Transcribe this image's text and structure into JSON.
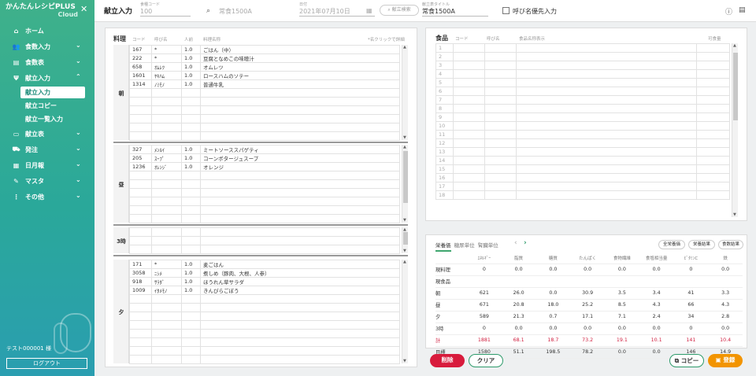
{
  "app": {
    "title_line1": "かんたんレシピPLUS",
    "title_line2": "Cloud"
  },
  "sidebar": {
    "items": [
      {
        "icon": "home-icon",
        "label": "ホーム",
        "chev": ""
      },
      {
        "icon": "people-icon",
        "label": "食数入力",
        "chev": "⌄"
      },
      {
        "icon": "table-icon",
        "label": "食数表",
        "chev": "⌄"
      },
      {
        "icon": "utensils-icon",
        "label": "献立入力",
        "chev": "⌃"
      }
    ],
    "sub_items": [
      {
        "label": "献立入力",
        "active": true
      },
      {
        "label": "献立コピー",
        "active": false
      },
      {
        "label": "献立一覧入力",
        "active": false
      }
    ],
    "items2": [
      {
        "icon": "monitor-icon",
        "label": "献立表",
        "chev": "⌄"
      },
      {
        "icon": "truck-icon",
        "label": "発注",
        "chev": "⌄"
      },
      {
        "icon": "calendar-icon",
        "label": "日月報",
        "chev": "⌄"
      },
      {
        "icon": "pencil-icon",
        "label": "マスタ",
        "chev": "⌄"
      },
      {
        "icon": "dots-icon",
        "label": "その他",
        "chev": "⌄"
      }
    ],
    "user": "テスト000001 様",
    "logout": "ログアウト"
  },
  "topbar": {
    "title": "献立入力",
    "code_label": "食種コード",
    "code_value": "100",
    "meal_type": "常食1500A",
    "date_label": "日付",
    "date_value": "2021年07月10日",
    "search_btn": "献立検索",
    "menu_title_label": "献立表タイトル",
    "menu_title_value": "常食1500A",
    "pref_label": "呼び名優先入力"
  },
  "menu_panel": {
    "h_cuisine": "料理",
    "h_code": "コード",
    "h_alias": "呼び名",
    "h_servings": "人前",
    "h_name": "料理名称",
    "hint": "*名クリックで詳細",
    "meals": [
      {
        "label": "朝",
        "rows": [
          {
            "code": "167",
            "alias": "*",
            "serv": "1.0",
            "name": "ごはん（中）"
          },
          {
            "code": "222",
            "alias": "*",
            "serv": "1.0",
            "name": "豆腐となめこの味噌汁"
          },
          {
            "code": "658",
            "alias": "ｵﾑﾚﾂ",
            "serv": "1.0",
            "name": "オムレツ"
          },
          {
            "code": "1601",
            "alias": "ﾔｷﾊﾑ",
            "serv": "1.0",
            "name": "ロースハムのソテー"
          },
          {
            "code": "1314",
            "alias": "ﾉﾐﾓﾉ",
            "serv": "1.0",
            "name": "普通牛乳"
          }
        ]
      },
      {
        "label": "昼",
        "rows": [
          {
            "code": "327",
            "alias": "ﾒﾝﾙｲ",
            "serv": "1.0",
            "name": "ミートソーススパゲティ"
          },
          {
            "code": "205",
            "alias": "ｽｰﾌﾟ",
            "serv": "1.0",
            "name": "コーンポタージュスープ"
          },
          {
            "code": "1236",
            "alias": "ｵﾚﾝｼﾞ",
            "serv": "1.0",
            "name": "オレンジ"
          }
        ]
      },
      {
        "label": "3時",
        "rows": []
      },
      {
        "label": "夕",
        "rows": [
          {
            "code": "171",
            "alias": "*",
            "serv": "1.0",
            "name": "麦ごはん"
          },
          {
            "code": "3058",
            "alias": "ﾆｼﾒ",
            "serv": "1.0",
            "name": "煮しめ（豚肉、大根、人参）"
          },
          {
            "code": "918",
            "alias": "ｻﾗﾀﾞ",
            "serv": "1.0",
            "name": "ほうれん草サラダ"
          },
          {
            "code": "1009",
            "alias": "ｲﾀﾒﾓﾉ",
            "serv": "1.0",
            "name": "きんぴらごぼう"
          }
        ]
      }
    ]
  },
  "food_panel": {
    "h_food": "食品",
    "h_code": "コード",
    "h_alias": "呼び名",
    "h_name": "食品名称表示",
    "h_edible": "可食量",
    "rows": [
      "1",
      "2",
      "3",
      "4",
      "5",
      "6",
      "7",
      "8",
      "9",
      "10",
      "11",
      "12",
      "13",
      "14",
      "15",
      "16",
      "17",
      "18"
    ]
  },
  "nutrition": {
    "tabs": [
      "栄養価",
      "糖尿単位",
      "腎臓単位"
    ],
    "buttons": {
      "all": "全栄養価",
      "result": "栄養結果",
      "food": "食数結果"
    },
    "headers": [
      "",
      "ｴﾈﾙｷﾞｰ",
      "脂質",
      "糖質",
      "たんぱく",
      "食物繊維",
      "食塩相当量",
      "ﾋﾞﾀﾐﾝC",
      "鉄"
    ],
    "rows": [
      {
        "label": "現料理",
        "vals": [
          "0",
          "0.0",
          "0.0",
          "0.0",
          "0.0",
          "0.0",
          "0",
          "0.0"
        ],
        "total": false
      },
      {
        "label": "現食品",
        "vals": [
          "",
          "",
          "",
          "",
          "",
          "",
          "",
          ""
        ],
        "total": false
      },
      {
        "label": "朝",
        "vals": [
          "621",
          "26.0",
          "0.0",
          "30.9",
          "3.5",
          "3.4",
          "41",
          "3.3"
        ],
        "total": false
      },
      {
        "label": "昼",
        "vals": [
          "671",
          "20.8",
          "18.0",
          "25.2",
          "8.5",
          "4.3",
          "66",
          "4.3"
        ],
        "total": false
      },
      {
        "label": "夕",
        "vals": [
          "589",
          "21.3",
          "0.7",
          "17.1",
          "7.1",
          "2.4",
          "34",
          "2.8"
        ],
        "total": false
      },
      {
        "label": "3時",
        "vals": [
          "0",
          "0.0",
          "0.0",
          "0.0",
          "0.0",
          "0.0",
          "0",
          "0.0"
        ],
        "total": false
      },
      {
        "label": "計",
        "vals": [
          "1881",
          "68.1",
          "18.7",
          "73.2",
          "19.1",
          "10.1",
          "141",
          "10.4"
        ],
        "total": true
      },
      {
        "label": "目標",
        "vals": [
          "1580",
          "51.1",
          "198.5",
          "78.2",
          "0.0",
          "0.0",
          "146",
          "14.9"
        ],
        "total": false
      }
    ]
  },
  "actions": {
    "delete": "削除",
    "clear": "クリア",
    "copy": "コピー",
    "register": "登録"
  },
  "colors": {
    "accent": "#3fb18a",
    "danger": "#d81b3c",
    "warn": "#f29400",
    "total": "#d02040"
  }
}
